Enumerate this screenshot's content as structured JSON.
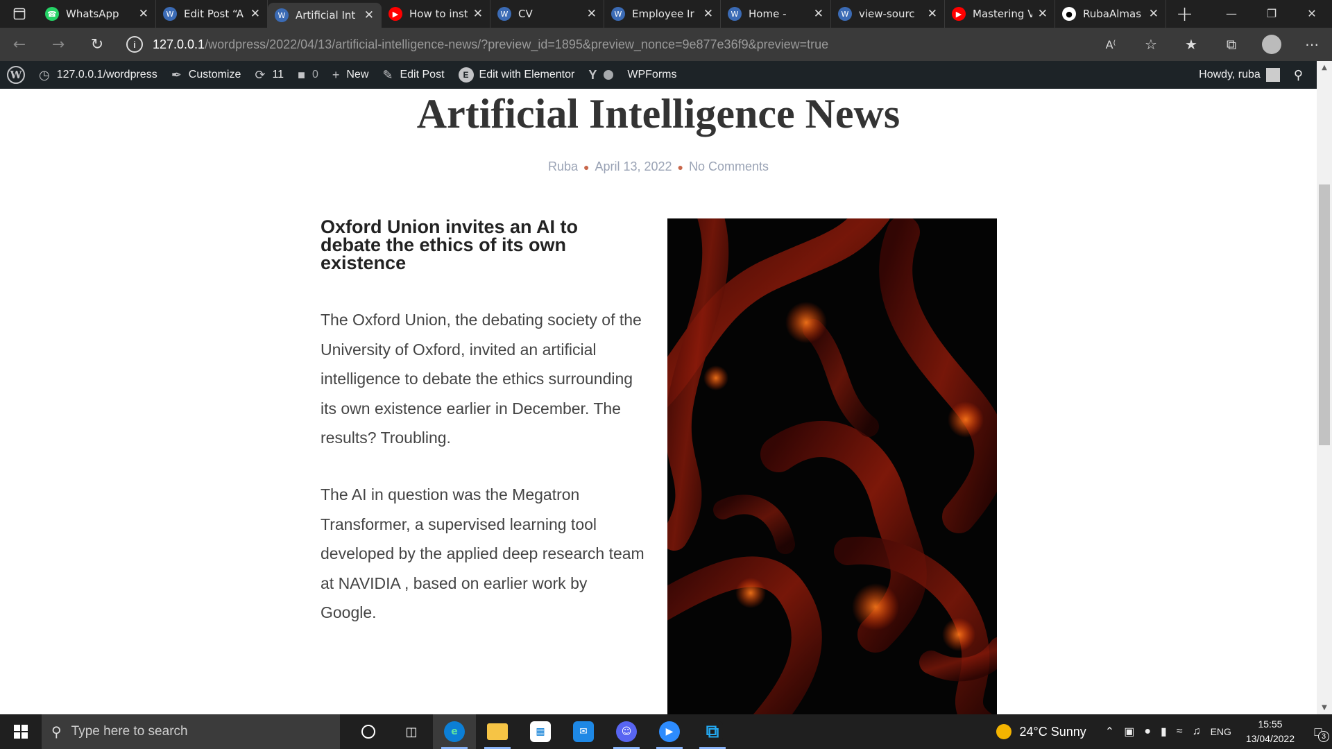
{
  "browser": {
    "tabs": [
      {
        "title": "WhatsApp",
        "icon": "whatsapp-icon",
        "color": "#25d366",
        "active": false
      },
      {
        "title": "Edit Post “A",
        "icon": "wordpress-site-icon",
        "color": "#3b6bb5",
        "active": false
      },
      {
        "title": "Artificial Int",
        "icon": "wordpress-site-icon",
        "color": "#3b6bb5",
        "active": true
      },
      {
        "title": "How to inst",
        "icon": "youtube-icon",
        "color": "#ff0000",
        "active": false
      },
      {
        "title": "CV",
        "icon": "wordpress-site-icon",
        "color": "#3b6bb5",
        "active": false
      },
      {
        "title": "Employee Ir",
        "icon": "wordpress-site-icon",
        "color": "#3b6bb5",
        "active": false
      },
      {
        "title": "Home -",
        "icon": "wordpress-site-icon",
        "color": "#3b6bb5",
        "active": false
      },
      {
        "title": "view-sourc",
        "icon": "wordpress-site-icon",
        "color": "#3b6bb5",
        "active": false
      },
      {
        "title": "Mastering V",
        "icon": "youtube-icon",
        "color": "#ff0000",
        "active": false
      },
      {
        "title": "RubaAlmas",
        "icon": "github-icon",
        "color": "#ffffff",
        "active": false
      }
    ],
    "url_host": "127.0.0.1",
    "url_path": "/wordpress/2022/04/13/artificial-intelligence-news/?preview_id=1895&preview_nonce=9e877e36f9&preview=true"
  },
  "adminbar": {
    "site": "127.0.0.1/wordpress",
    "customize": "Customize",
    "updates": "11",
    "comments": "0",
    "new": "New",
    "edit_post": "Edit Post",
    "elementor": "Edit with Elementor",
    "wpforms": "WPForms",
    "howdy": "Howdy, ruba"
  },
  "post": {
    "title": "Artificial Intelligence News",
    "author": "Ruba",
    "date": "April 13, 2022",
    "comments": "No Comments",
    "heading": "Oxford Union invites an AI to debate the ethics of its own existence",
    "paragraph1": "The Oxford Union, the debating society of the University of Oxford, invited an artificial intelligence to debate the ethics surrounding its own existence earlier in December. The results? Troubling.",
    "paragraph2": "The AI in question was the Megatron Transformer, a supervised learning tool developed by the applied deep research team at NAVIDIA , based on earlier work by Google."
  },
  "taskbar": {
    "search_placeholder": "Type here to search",
    "weather": "24°C  Sunny",
    "lang": "ENG",
    "time": "15:55",
    "date": "13/04/2022",
    "notifications": "3"
  },
  "colors": {
    "tabbar": "#202020",
    "addressbar": "#3a3a3a",
    "adminbar": "#1d2327",
    "meta": "#9aa3b5",
    "meta_dot": "#c8674b",
    "heading": "#222222",
    "body": "#444444"
  }
}
